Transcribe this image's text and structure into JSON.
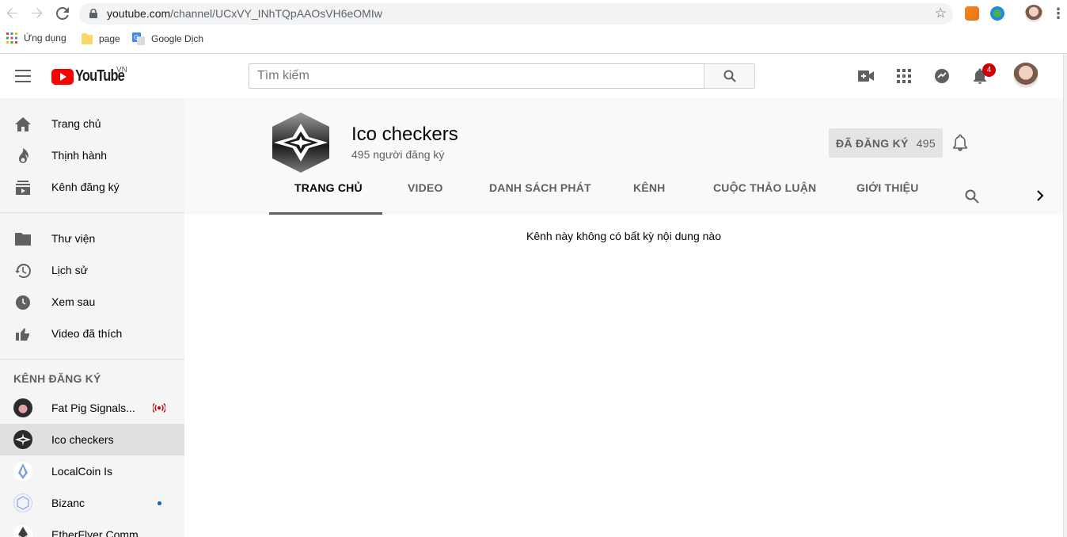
{
  "browser": {
    "url_host": "youtube.com",
    "url_path": "/channel/UCxVY_INhTQpAAOsVH6eOMIw",
    "bookmarks": [
      {
        "label": "Ứng dụng",
        "icon": "apps-grid-icon"
      },
      {
        "label": "page",
        "icon": "folder-icon"
      },
      {
        "label": "Google Dịch",
        "icon": "google-translate-icon"
      }
    ]
  },
  "masthead": {
    "logo_text": "YouTube",
    "country_code": "VN",
    "search_placeholder": "Tìm kiếm",
    "notification_count": "4"
  },
  "sidebar": {
    "main": [
      {
        "label": "Trang chủ",
        "icon": "home-icon"
      },
      {
        "label": "Thịnh hành",
        "icon": "fire-icon"
      },
      {
        "label": "Kênh đăng ký",
        "icon": "subscriptions-icon"
      }
    ],
    "library": [
      {
        "label": "Thư viện",
        "icon": "folder-icon"
      },
      {
        "label": "Lịch sử",
        "icon": "history-icon"
      },
      {
        "label": "Xem sau",
        "icon": "clock-icon"
      },
      {
        "label": "Video đã thích",
        "icon": "thumb-up-icon"
      }
    ],
    "subscriptions_heading": "KÊNH ĐĂNG KÝ",
    "subscriptions": [
      {
        "label": "Fat Pig Signals...",
        "status": "live"
      },
      {
        "label": "Ico checkers",
        "status": "active"
      },
      {
        "label": "LocalCoin Is",
        "status": ""
      },
      {
        "label": "Bizanc",
        "status": "new"
      },
      {
        "label": "EtherFlyer Comm...",
        "status": ""
      }
    ]
  },
  "channel": {
    "name": "Ico checkers",
    "subscribers": "495 người đăng ký",
    "subscribe_label": "ĐÃ ĐĂNG KÝ",
    "subscribe_count": "495",
    "tabs": [
      "TRANG CHỦ",
      "VIDEO",
      "DANH SÁCH PHÁT",
      "KÊNH",
      "CUỘC THẢO LUẬN",
      "GIỚI THIỆU"
    ],
    "active_tab": "TRANG CHỦ",
    "empty_message": "Kênh này không có bất kỳ nội dung nào"
  },
  "colors": {
    "brand_red": "#ff0000",
    "badge_red": "#cc0000",
    "live_red": "#cc0000",
    "new_dot_blue": "#065fd4"
  }
}
